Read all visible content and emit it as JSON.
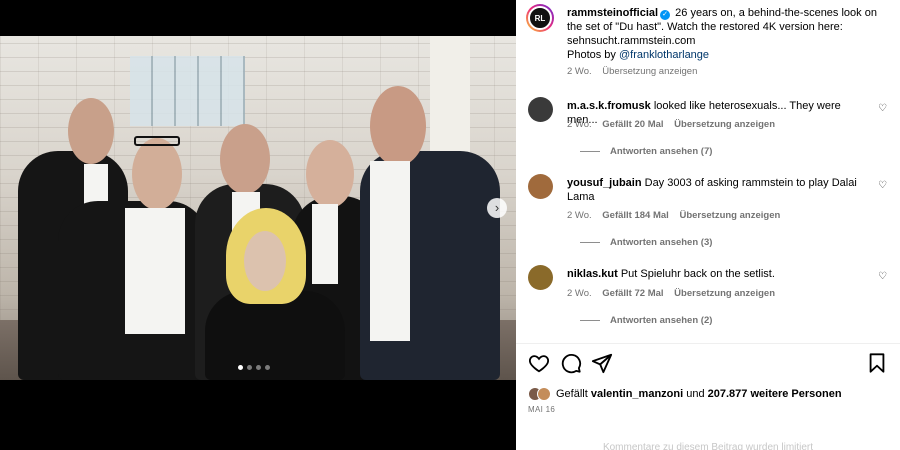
{
  "post": {
    "username": "rammsteinofficial",
    "caption": "26 years on, a behind-the-scenes look on the set of \"Du hast\". Watch the restored 4K version here: sehnsucht.rammstein.com",
    "photos_by_label": "Photos by",
    "photos_by_handle": "@franklotharlange",
    "time": "2 Wo.",
    "translate": "Übersetzung anzeigen",
    "avatar_text": "RL"
  },
  "comments": [
    {
      "username": "m.a.s.k.fromusk",
      "text": "looked like heterosexuals... They were men...",
      "time": "2 Wo.",
      "likes": "Gefällt 20 Mal",
      "translate": "Übersetzung anzeigen",
      "replies": "Antworten ansehen (7)",
      "avatar_color": "#3a3a3a"
    },
    {
      "username": "yousuf_jubain",
      "text": "Day 3003 of asking rammstein to play Dalai Lama",
      "time": "2 Wo.",
      "likes": "Gefällt 184 Mal",
      "translate": "Übersetzung anzeigen",
      "replies": "Antworten ansehen (3)",
      "avatar_color": "#a06a3c"
    },
    {
      "username": "niklas.kut",
      "text": "Put Spieluhr back on the setlist.",
      "time": "2 Wo.",
      "likes": "Gefällt 72 Mal",
      "translate": "Übersetzung anzeigen",
      "replies": "Antworten ansehen (2)",
      "avatar_color": "#8a6a2a"
    }
  ],
  "likes_summary": {
    "prefix": "Gefällt",
    "user": "valentin_manzoni",
    "middle": "und",
    "count": "207.877 weitere Personen"
  },
  "date": "MAI 16",
  "comments_disabled": "Kommentare zu diesem Beitrag wurden limitiert",
  "carousel": {
    "total": 4,
    "active": 1
  },
  "icons": [
    "heart-icon",
    "comment-icon",
    "share-icon",
    "bookmark-icon",
    "chevron-right-icon",
    "verified-icon"
  ],
  "colors": {
    "link": "#00376b",
    "verified": "#0095f6",
    "muted": "#737373"
  }
}
